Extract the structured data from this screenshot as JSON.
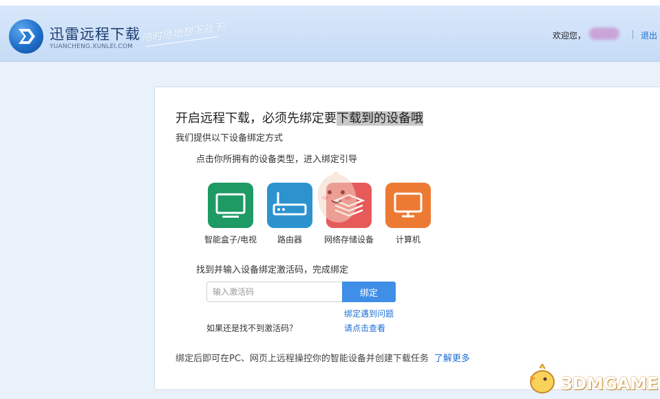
{
  "header": {
    "brand_title": "迅雷远程下载",
    "brand_sub": "YUANCHENG.XUNLEI.COM",
    "slogan": "随时随地想下就下!",
    "welcome": "欢迎您，",
    "logout": "退出"
  },
  "main": {
    "title_prefix": "开启远程下载，必须先绑定要",
    "title_highlight": "下载到的设备哦",
    "subtitle": "我们提供以下设备绑定方式",
    "guide": "点击你所拥有的设备类型，进入绑定引导",
    "devices": [
      {
        "label": "智能盒子/电视",
        "icon": "tv-icon",
        "color": "#1e9a64"
      },
      {
        "label": "路由器",
        "icon": "router-icon",
        "color": "#2d93cf"
      },
      {
        "label": "网络存储设备",
        "icon": "nas-icon",
        "color": "#e65a5a"
      },
      {
        "label": "计算机",
        "icon": "computer-icon",
        "color": "#ec7a33"
      }
    ],
    "find_text": "找到并输入设备绑定激活码，完成绑定",
    "input_placeholder": "输入激活码",
    "bind_button": "绑定",
    "help_link_1": "绑定遇到问题",
    "no_code_text": "如果还是找不到激活码？",
    "help_link_2": "请点击查看",
    "footer_text": "绑定后即可在PC、网页上远程操控你的智能设备并创建下载任务",
    "learn_more": "了解更多"
  },
  "watermark": {
    "text": "3DMGAME"
  }
}
